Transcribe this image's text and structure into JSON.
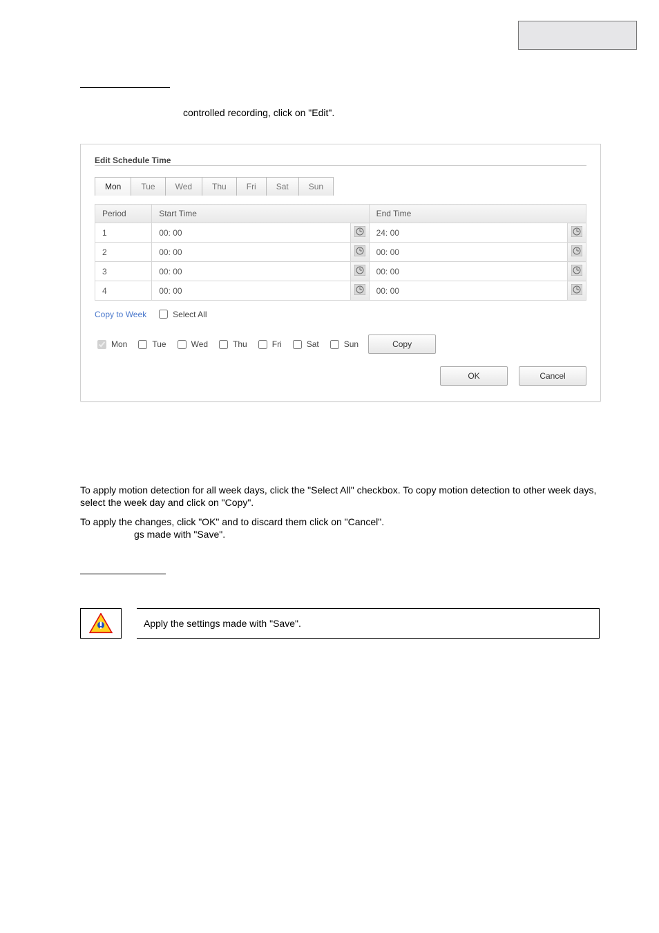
{
  "intro_text": "controlled recording, click on \"Edit\".",
  "dialog": {
    "title": "Edit Schedule Time",
    "tabs": [
      "Mon",
      "Tue",
      "Wed",
      "Thu",
      "Fri",
      "Sat",
      "Sun"
    ],
    "active_tab_index": 0,
    "headers": {
      "period": "Period",
      "start": "Start Time",
      "end": "End Time"
    },
    "rows": [
      {
        "period": "1",
        "start": "00: 00",
        "end": "24: 00"
      },
      {
        "period": "2",
        "start": "00: 00",
        "end": "00: 00"
      },
      {
        "period": "3",
        "start": "00: 00",
        "end": "00: 00"
      },
      {
        "period": "4",
        "start": "00: 00",
        "end": "00: 00"
      }
    ],
    "copy_label": "Copy to Week",
    "select_all_label": "Select All",
    "day_labels": [
      "Mon",
      "Tue",
      "Wed",
      "Thu",
      "Fri",
      "Sat",
      "Sun"
    ],
    "day_checked": [
      true,
      false,
      false,
      false,
      false,
      false,
      false
    ],
    "copy_button": "Copy",
    "ok_button": "OK",
    "cancel_button": "Cancel"
  },
  "paragraph_copy": "To apply motion detection for all week days, click the \"Select All\" checkbox. To copy motion detection to other week days, select the week day and click on \"Copy\".",
  "paragraph_apply_line1": "To apply the changes, click \"OK\" and to discard them click on \"Cancel\".",
  "paragraph_apply_line2": "gs made with \"Save\".",
  "note_text": "Apply the settings made with \"Save\"."
}
